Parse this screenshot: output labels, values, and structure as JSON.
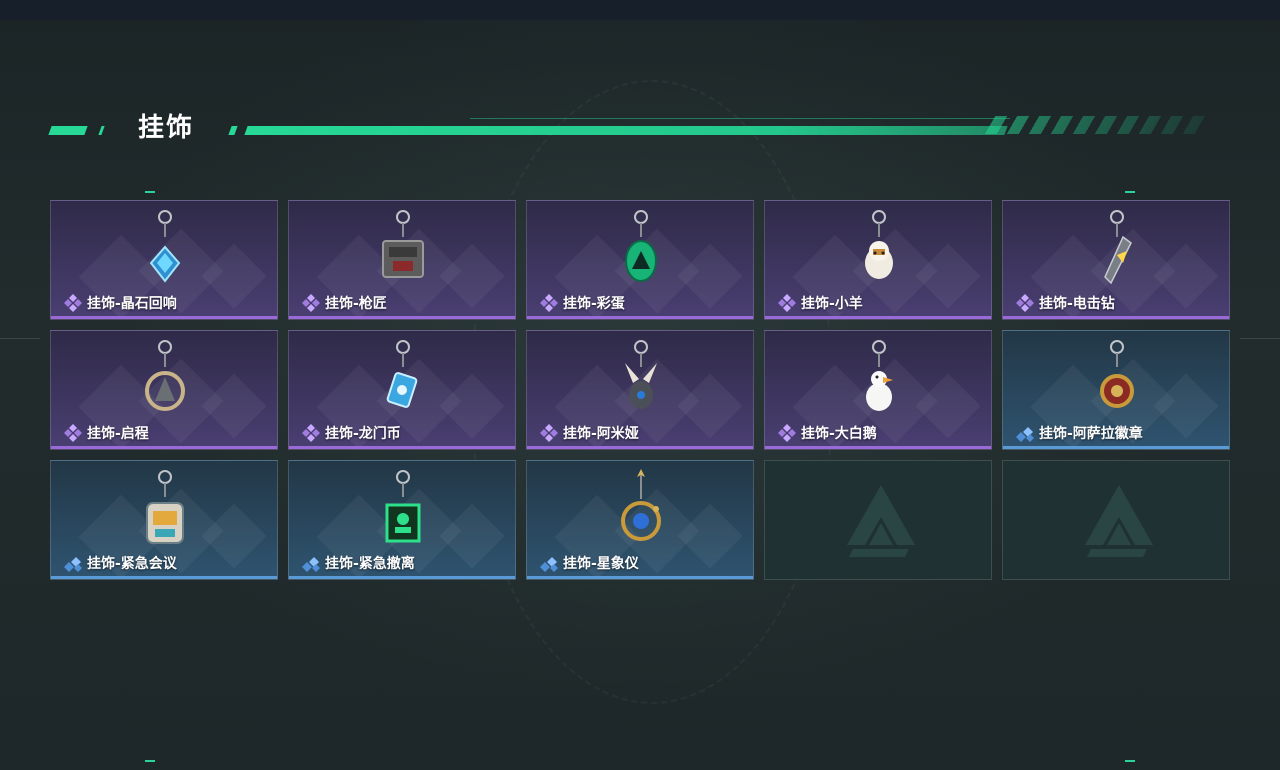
{
  "page": {
    "title": "挂饰"
  },
  "colors": {
    "accent": "#27d896",
    "rare_purple": "#9a6ad8",
    "rare_blue": "#5a9ad6",
    "card_purple_top": "#2f2a48",
    "card_blue_top": "#223746"
  },
  "items": [
    {
      "label": "挂饰-晶石回响",
      "rarity": "purple",
      "icon": "crystal-charm-icon"
    },
    {
      "label": "挂饰-枪匠",
      "rarity": "purple",
      "icon": "gunsmith-charm-icon"
    },
    {
      "label": "挂饰-彩蛋",
      "rarity": "purple",
      "icon": "easter-egg-charm-icon"
    },
    {
      "label": "挂饰-小羊",
      "rarity": "purple",
      "icon": "lamb-charm-icon"
    },
    {
      "label": "挂饰-电击钻",
      "rarity": "purple",
      "icon": "shock-drill-charm-icon"
    },
    {
      "label": "挂饰-启程",
      "rarity": "purple",
      "icon": "departure-charm-icon"
    },
    {
      "label": "挂饰-龙门币",
      "rarity": "purple",
      "icon": "lungmen-coin-charm-icon"
    },
    {
      "label": "挂饰-阿米娅",
      "rarity": "purple",
      "icon": "amiya-charm-icon"
    },
    {
      "label": "挂饰-大白鹅",
      "rarity": "purple",
      "icon": "white-goose-charm-icon"
    },
    {
      "label": "挂饰-阿萨拉徽章",
      "rarity": "blue",
      "icon": "asala-badge-charm-icon"
    },
    {
      "label": "挂饰-紧急会议",
      "rarity": "blue",
      "icon": "emergency-meeting-charm-icon"
    },
    {
      "label": "挂饰-紧急撤离",
      "rarity": "blue",
      "icon": "emergency-evac-charm-icon"
    },
    {
      "label": "挂饰-星象仪",
      "rarity": "blue",
      "icon": "astrolabe-charm-icon"
    }
  ],
  "empty_slots": 2
}
